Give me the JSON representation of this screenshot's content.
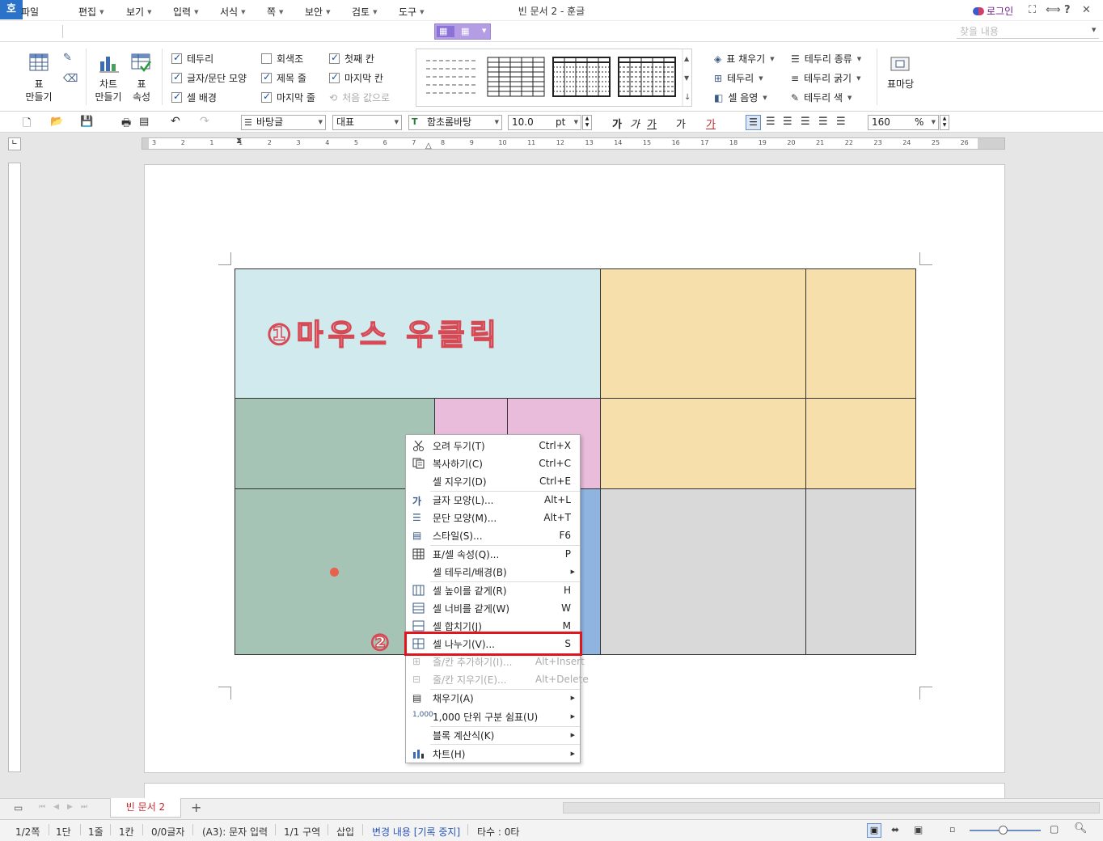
{
  "window": {
    "title": "빈 문서 2 - 훈글",
    "app_icon": "호",
    "login": "로그인",
    "controls": [
      "⛶",
      "⟺",
      "?"
    ]
  },
  "menu": [
    "파일",
    "편집",
    "보기",
    "입력",
    "서식",
    "쪽",
    "보안",
    "검토",
    "도구"
  ],
  "search": {
    "placeholder": "찾을 내용"
  },
  "ribbon": {
    "table_make": "표\n만들기",
    "chart_make": "차트\n만들기",
    "table_prop": "표\n속성",
    "checks": [
      {
        "label": "테두리",
        "checked": true
      },
      {
        "label": "글자/문단 모양",
        "checked": true
      },
      {
        "label": "셀 배경",
        "checked": true
      },
      {
        "label": "회색조",
        "checked": false
      },
      {
        "label": "제목 줄",
        "checked": true
      },
      {
        "label": "마지막 줄",
        "checked": true
      },
      {
        "label": "첫째 칸",
        "checked": true
      },
      {
        "label": "마지막 칸",
        "checked": true
      },
      {
        "label": "처음 값으로",
        "checked": false
      }
    ],
    "fill_items": [
      "표 채우기",
      "테두리",
      "셀 음영"
    ],
    "border_items": [
      "테두리 종류",
      "테두리 굵기",
      "테두리 색"
    ],
    "table_madang": "표마당"
  },
  "toolbar": {
    "style": "바탕글",
    "lang": "대표",
    "font": "함초롬바탕",
    "size": "10.0",
    "unit": "pt",
    "zoom": "160",
    "zoom_unit": "%",
    "font_buttons": [
      "가",
      "가",
      "가",
      "가",
      "가"
    ]
  },
  "ruler": {
    "h_ticks": [
      "3",
      "2",
      "1",
      "1",
      "2",
      "3",
      "4",
      "5",
      "6",
      "7",
      "8",
      "9",
      "10",
      "11",
      "12",
      "13",
      "14",
      "15",
      "16",
      "17",
      "18",
      "19",
      "20",
      "21",
      "22",
      "23",
      "24",
      "25",
      "26"
    ]
  },
  "document": {
    "overlay_text": "①마우스 우클릭",
    "callout": "②",
    "colors": {
      "blue": "#d1eaee",
      "orange": "#f6dfaa",
      "green": "#a5c4b6",
      "pink": "#e8bcda",
      "lightblue": "#8fb4e0",
      "gray": "#d9d9d9"
    }
  },
  "context_menu": [
    {
      "label": "오려 두기(T)",
      "shortcut": "Ctrl+X",
      "icon": "scissors-icon"
    },
    {
      "label": "복사하기(C)",
      "shortcut": "Ctrl+C",
      "icon": "copy-icon"
    },
    {
      "label": "셀 지우기(D)",
      "shortcut": "Ctrl+E",
      "icon": ""
    },
    {
      "label": "글자 모양(L)...",
      "shortcut": "Alt+L",
      "icon": "char-shape-icon"
    },
    {
      "label": "문단 모양(M)...",
      "shortcut": "Alt+T",
      "icon": "para-shape-icon"
    },
    {
      "label": "스타일(S)...",
      "shortcut": "F6",
      "icon": "style-icon"
    },
    {
      "label": "표/셀 속성(Q)...",
      "shortcut": "P",
      "icon": "table-prop-icon"
    },
    {
      "label": "셀 테두리/배경(B)",
      "shortcut": "",
      "icon": "",
      "sub": true
    },
    {
      "label": "셀 높이를 같게(R)",
      "shortcut": "H",
      "icon": "equal-height-icon"
    },
    {
      "label": "셀 너비를 같게(W)",
      "shortcut": "W",
      "icon": "equal-width-icon"
    },
    {
      "label": "셀 합치기(J)",
      "shortcut": "M",
      "icon": "merge-icon"
    },
    {
      "label": "셀 나누기(V)...",
      "shortcut": "S",
      "icon": "split-icon"
    },
    {
      "label": "줄/칸 추가하기(I)...",
      "shortcut": "Alt+Insert",
      "icon": "add-rowcol-icon",
      "disabled": true
    },
    {
      "label": "줄/칸 지우기(E)...",
      "shortcut": "Alt+Delete",
      "icon": "del-rowcol-icon",
      "disabled": true
    },
    {
      "label": "채우기(A)",
      "shortcut": "",
      "icon": "fill-icon",
      "sub": true
    },
    {
      "label": "1,000 단위 구분 쉼표(U)",
      "shortcut": "",
      "icon": "thousand-icon",
      "sub": true
    },
    {
      "label": "블록 계산식(K)",
      "shortcut": "",
      "icon": "",
      "sub": true
    },
    {
      "label": "차트(H)",
      "shortcut": "",
      "icon": "chart-icon",
      "sub": true
    }
  ],
  "tabs": {
    "doc": "빈 문서 2",
    "add": "+"
  },
  "status": [
    "1/2쪽",
    "1단",
    "1줄",
    "1칸",
    "0/0글자",
    "(A3): 문자 입력",
    "1/1 구역",
    "삽입",
    "변경 내용 [기록 중지]",
    "타수 : 0타"
  ]
}
